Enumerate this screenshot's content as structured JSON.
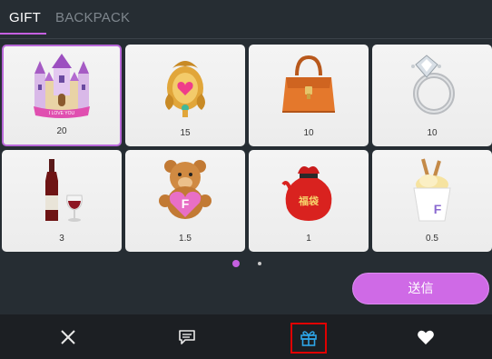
{
  "tabs": {
    "gift_label": "GIFT",
    "backpack_label": "BACKPACK"
  },
  "gifts": [
    {
      "name": "castle",
      "price": "20",
      "selected": true
    },
    {
      "name": "golden-heart-ornament",
      "price": "15",
      "selected": false
    },
    {
      "name": "orange-handbag",
      "price": "10",
      "selected": false
    },
    {
      "name": "diamond-ring",
      "price": "10",
      "selected": false
    },
    {
      "name": "wine-bottle-glass",
      "price": "3",
      "selected": false
    },
    {
      "name": "teddy-bear",
      "price": "1.5",
      "selected": false
    },
    {
      "name": "lucky-bag",
      "price": "1",
      "selected": false
    },
    {
      "name": "ice-cream-cup",
      "price": "0.5",
      "selected": false
    }
  ],
  "castle_banner": "I LOVE YOU",
  "teddy_letter": "F",
  "icecream_letter": "F",
  "luckybag_text": "福袋",
  "pagination": {
    "current": 1,
    "total": 2
  },
  "send_button_label": "送信",
  "bottom_bar": {
    "close_icon": "close-icon",
    "chat_icon": "chat-icon",
    "gift_icon": "gift-icon",
    "heart_icon": "heart-icon"
  },
  "colors": {
    "accent": "#c560e0",
    "send_button": "#cf6ae6",
    "highlight_box": "#e00000",
    "gift_icon_active": "#2ea6e8"
  }
}
